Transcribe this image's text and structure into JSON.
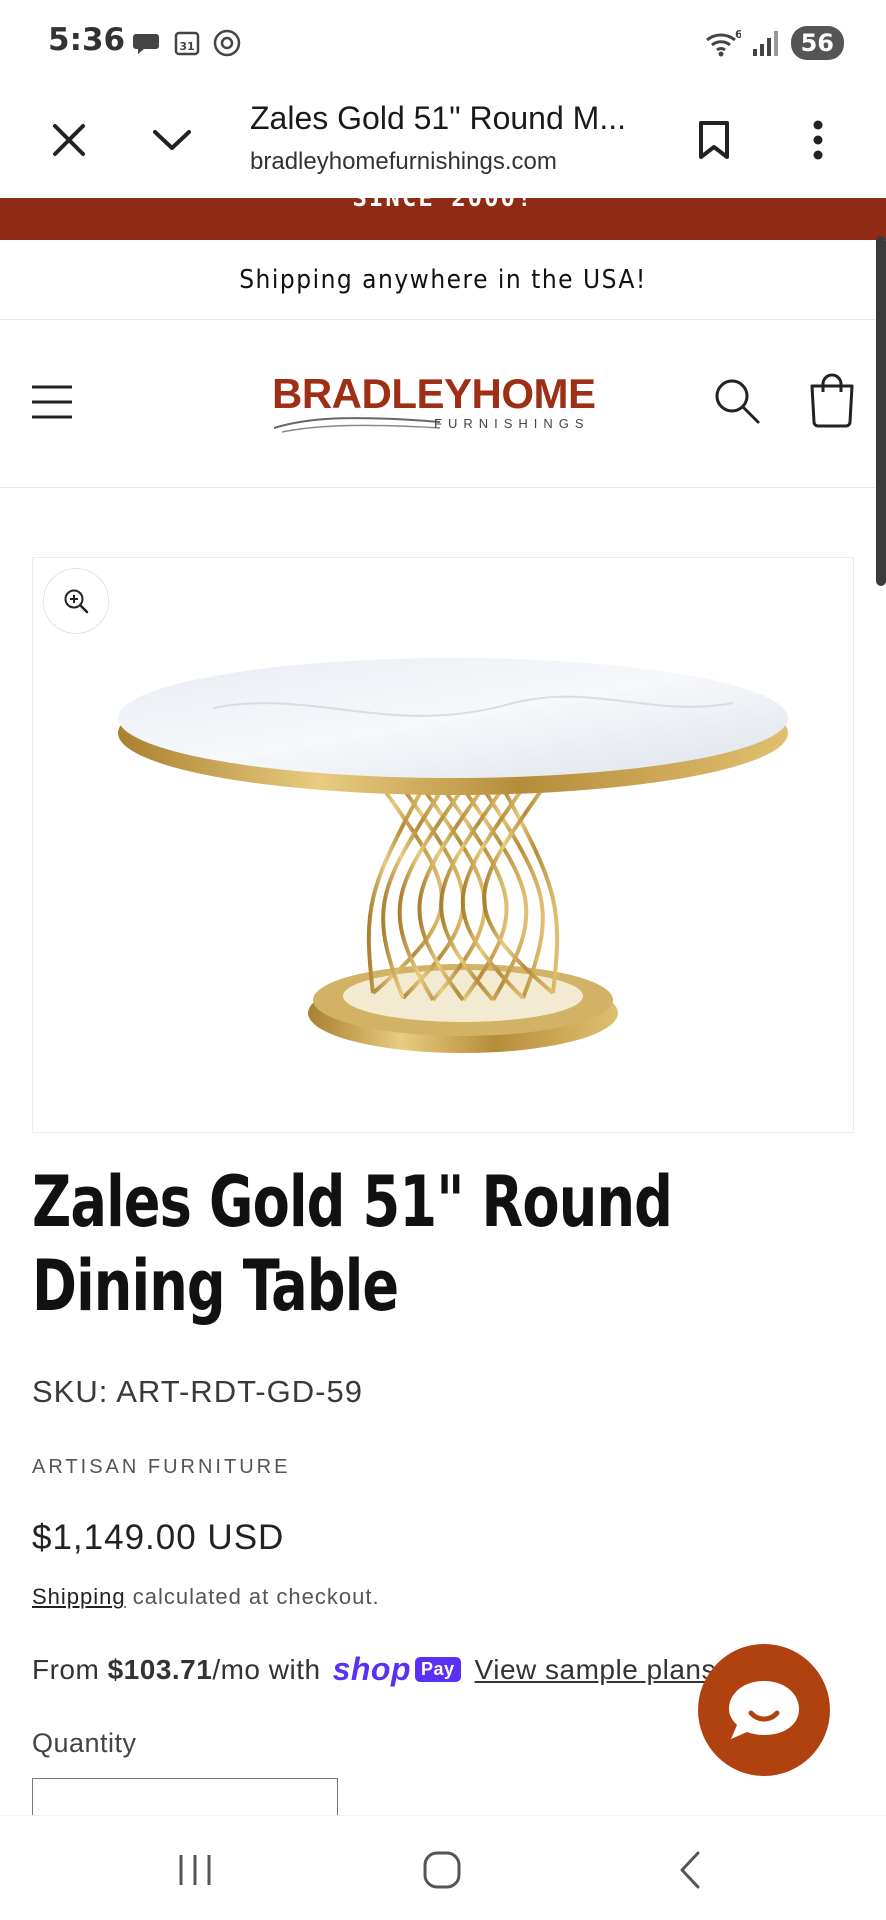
{
  "status_bar": {
    "time": "5:36",
    "battery": "56",
    "wifi_badge": "6"
  },
  "browser": {
    "title": "Zales Gold 51\" Round M...",
    "url": "bradleyhomefurnishings.com"
  },
  "announcement": {
    "text": "SINCE 2000!"
  },
  "shipping_banner": {
    "text": "Shipping anywhere in the USA!"
  },
  "header": {
    "logo_main": "BRADLEYHOME",
    "logo_sub": "FURNISHINGS"
  },
  "product": {
    "title": "Zales Gold 51\" Round Dining Table",
    "sku": "SKU: ART-RDT-GD-59",
    "vendor": "ARTISAN FURNITURE",
    "price": "$1,149.00 USD",
    "shipping_link": "Shipping",
    "shipping_note": " calculated at checkout.",
    "installment_prefix": "From ",
    "installment_amount": "$103.71",
    "installment_suffix": "/mo with",
    "shop_pay_word": "shop",
    "shop_pay_badge": "Pay",
    "sample_plans_link": "View sample plans",
    "quantity_label": "Quantity"
  },
  "colors": {
    "accent": "#8f2a14",
    "chat": "#b0420f",
    "shop_pay": "#5a31f4",
    "gold": "#c9a24a"
  }
}
